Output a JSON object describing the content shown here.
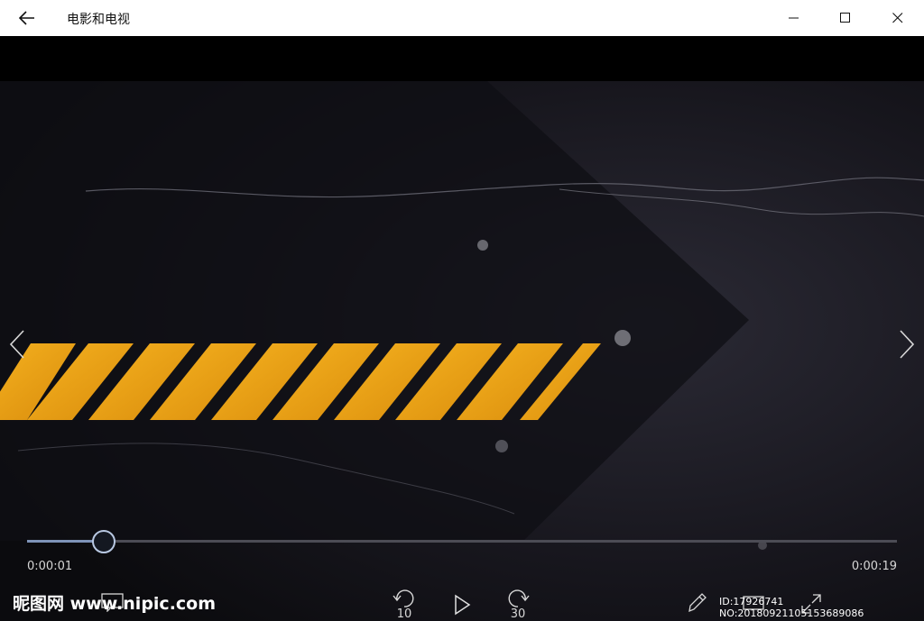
{
  "window": {
    "title": "电影和电视"
  },
  "player": {
    "elapsed": "0:00:01",
    "total": "0:00:19",
    "progress_fraction": 0.087,
    "skip_back_seconds": "10",
    "skip_forward_seconds": "30"
  },
  "watermark": {
    "brand": "昵图网 www.nipic.com",
    "id_text": "ID:17926741 NO:20180921105153689086"
  },
  "icons": {
    "back": "back-arrow-icon",
    "minimize": "minimize-icon",
    "maximize": "maximize-icon",
    "close": "close-icon",
    "prev": "chevron-left-icon",
    "next": "chevron-right-icon",
    "play": "play-icon",
    "edit": "pencil-icon",
    "fullscreen": "expand-icon"
  },
  "colors": {
    "stripe": "#f2a81a",
    "progress_fill": "#7e93b8"
  }
}
